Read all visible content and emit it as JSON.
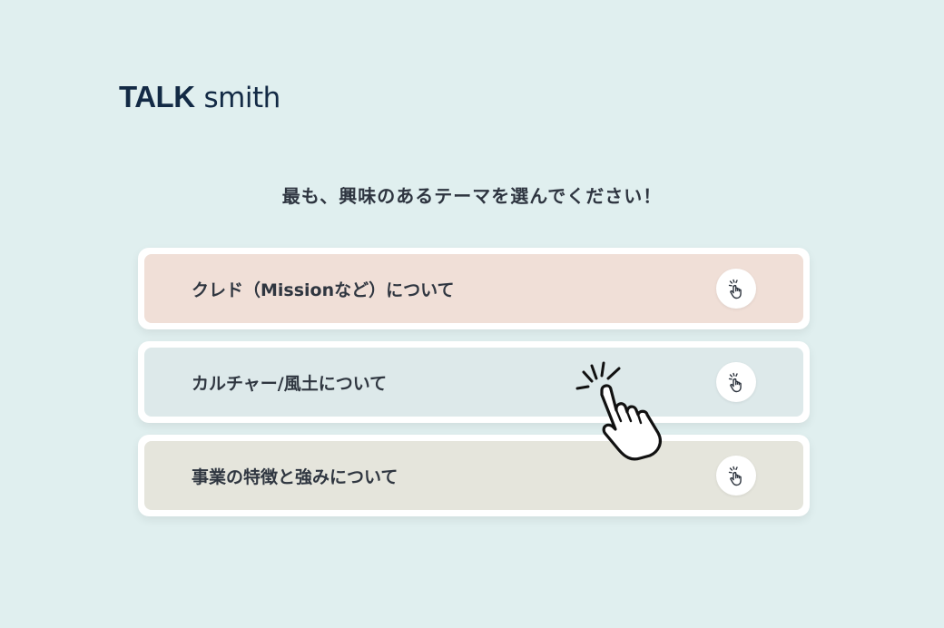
{
  "brand": {
    "name_bold": "TALK",
    "name_light": "smith"
  },
  "prompt": "最も、興味のあるテーマを選んでください！",
  "options": [
    {
      "label": "クレド（Missionなど）について",
      "color": "#f0dfd7"
    },
    {
      "label": "カルチャー/風土について",
      "color": "#dde9ea"
    },
    {
      "label": "事業の特徴と強みについて",
      "color": "#e5e5dc"
    }
  ],
  "icons": {
    "option_button": "tap-hand-icon",
    "cursor": "hand-pointer-icon"
  }
}
